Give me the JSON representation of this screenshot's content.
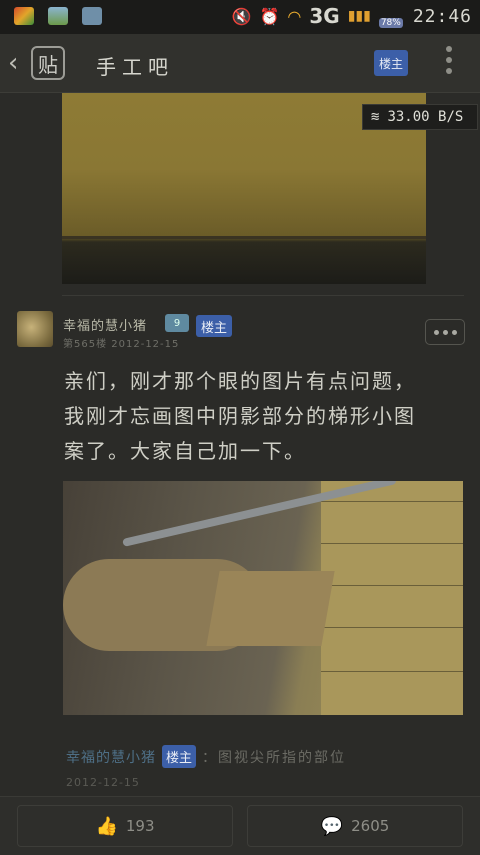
{
  "statusbar": {
    "time": "22:46",
    "network": "3G",
    "battery": "78%",
    "icons": [
      "shield-app-icon",
      "gallery-icon",
      "eye-app-icon",
      "mute-icon",
      "alarm-icon",
      "wifi-icon",
      "signal-icon",
      "weather-icon"
    ]
  },
  "topbar": {
    "back_icon": "‹",
    "logo": "贴",
    "title": "手工吧",
    "louzhu_button": "楼主"
  },
  "speed_overlay": {
    "value": "33.00 B/S"
  },
  "post": {
    "username": "幸福的慧小猪",
    "level": "9",
    "badge": "楼主",
    "floor": "第565楼 2012-12-15",
    "text": "亲们，刚才那个眼的图片有点问题，我刚才忘画图中阴影部分的梯形小图案了。大家自己加一下。"
  },
  "reply": {
    "name": "幸福的慧小猪",
    "badge": "楼主",
    "text": "：图视尖所指的部位",
    "time": "2012-12-15"
  },
  "bottombar": {
    "like_count": "193",
    "comment_count": "2605"
  },
  "colors": {
    "accent": "#3c5fa8",
    "background": "#2b2b28"
  }
}
